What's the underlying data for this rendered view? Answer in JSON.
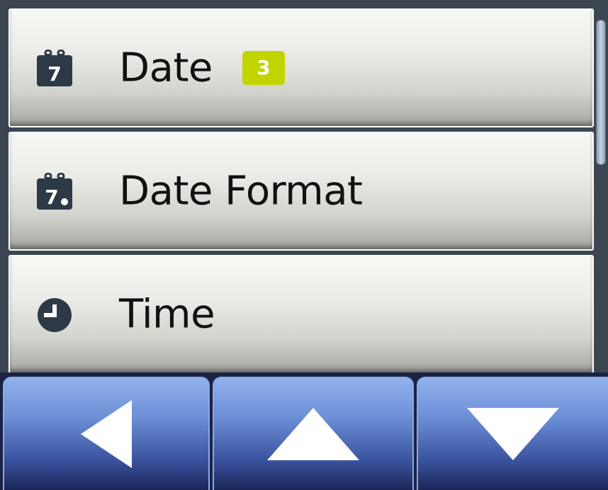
{
  "menu": {
    "items": [
      {
        "label": "Date",
        "icon": "calendar-icon",
        "badge": "3"
      },
      {
        "label": "Date Format",
        "icon": "calendar-format-icon"
      },
      {
        "label": "Time",
        "icon": "clock-icon"
      }
    ]
  },
  "nav": {
    "buttons": [
      {
        "icon": "arrow-left-icon"
      },
      {
        "icon": "arrow-up-icon"
      },
      {
        "icon": "arrow-down-icon"
      }
    ]
  },
  "colors": {
    "badge": "#c2d400",
    "icon": "#2c3a47",
    "nav_top": "#92b2ee",
    "nav_bottom": "#1b2656"
  }
}
